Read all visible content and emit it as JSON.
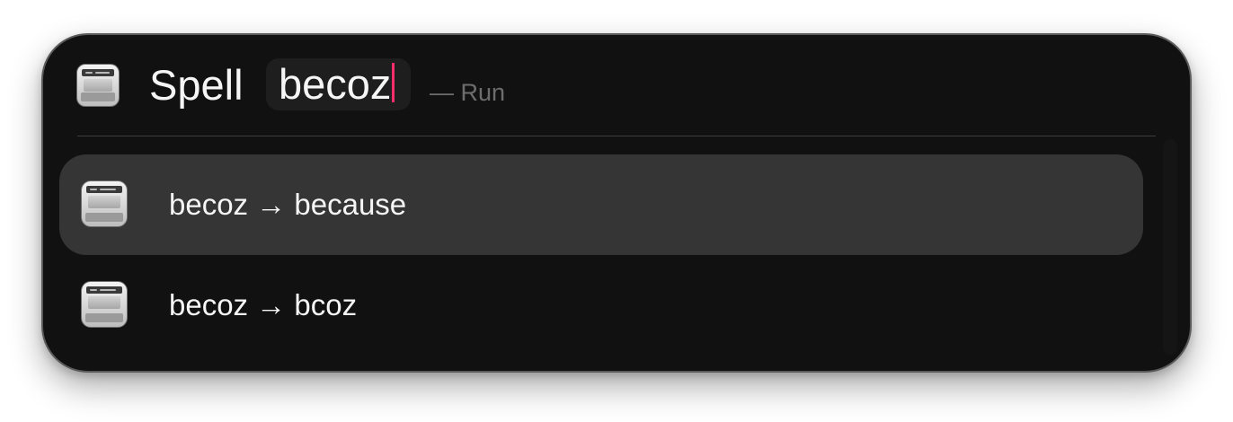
{
  "header": {
    "command_label": "Spell",
    "query_value": "becoz",
    "hint": "— Run",
    "icon": "spelling-keyboard-icon"
  },
  "results": [
    {
      "title": "becoz → because",
      "selected": true,
      "icon": "spelling-keyboard-icon"
    },
    {
      "title": "becoz → bcoz",
      "selected": false,
      "icon": "spelling-keyboard-icon"
    }
  ],
  "colors": {
    "window_bg": "#111111",
    "selected_row": "#353535",
    "caret": "#ff2d6b",
    "hint_text": "#6d6d6d",
    "text": "#f5f5f5"
  }
}
